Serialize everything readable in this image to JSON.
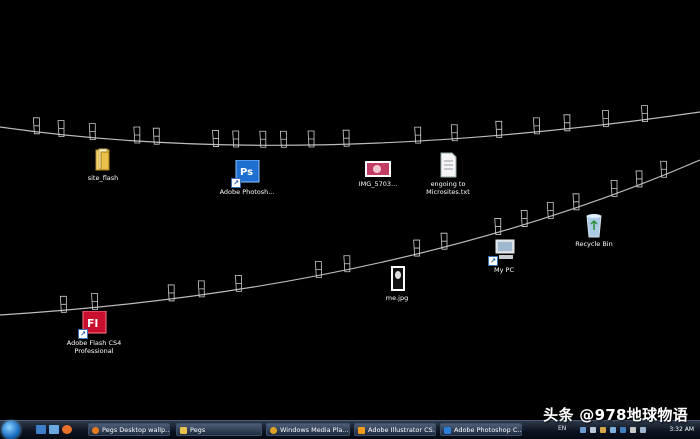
{
  "desktop": {
    "icons": [
      {
        "label": "site_flash",
        "icon": "folder-icon"
      },
      {
        "label": "Adobe Photosh...",
        "icon": "photoshop-icon"
      },
      {
        "label": "IMG_5703...",
        "icon": "image-thumbnail-icon"
      },
      {
        "label": "engoing to Microsites.txt",
        "icon": "text-file-icon"
      },
      {
        "label": "Recycle Bin",
        "icon": "recycle-bin-icon"
      },
      {
        "label": "My PC",
        "icon": "computer-icon"
      },
      {
        "label": "me.jpg",
        "icon": "image-thumbnail-icon"
      },
      {
        "label": "Adobe Flash CS4 Professional",
        "icon": "flash-icon"
      }
    ],
    "background": "#000000"
  },
  "taskbar": {
    "tasks": [
      {
        "label": "Pegs Desktop wallp...",
        "icon": "firefox-icon",
        "color": "#e87a1e"
      },
      {
        "label": "Pegs",
        "icon": "folder-icon",
        "color": "#e7c24d"
      },
      {
        "label": "Windows Media Pla...",
        "icon": "media-player-icon",
        "color": "#e0a226"
      },
      {
        "label": "Adobe Illustrator CS...",
        "icon": "illustrator-icon",
        "color": "#f39c1b"
      },
      {
        "label": "Adobe Photoshop C...",
        "icon": "photoshop-icon",
        "color": "#2a7ed8"
      }
    ],
    "language": "EN",
    "clock": "3:32 AM"
  },
  "watermark": "头条 @978地球物语",
  "colors": {
    "flash_red": "#c8102e",
    "photoshop_blue": "#1f6fd1"
  }
}
